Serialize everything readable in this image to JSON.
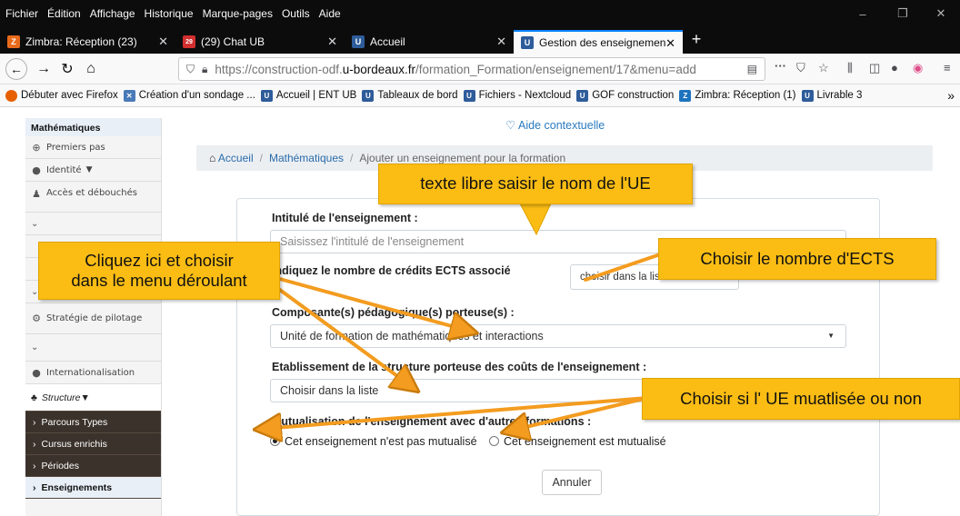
{
  "menubar": {
    "items": [
      "Fichier",
      "Édition",
      "Affichage",
      "Historique",
      "Marque-pages",
      "Outils",
      "Aide"
    ],
    "minimize": "–",
    "maximize": "❐",
    "close": "✕"
  },
  "tabs": [
    {
      "label": "Zimbra: Réception (23)",
      "favicon_color": "#e86a1b",
      "favicon_text": "Z"
    },
    {
      "label": "(29) Chat UB",
      "favicon_color": "#d32f2f",
      "favicon_text": "29"
    },
    {
      "label": "Accueil",
      "favicon_color": "#2e5c9a",
      "favicon_text": "U"
    },
    {
      "label": "Gestion des enseignemen",
      "favicon_color": "#2e5c9a",
      "favicon_text": "U",
      "active": true
    }
  ],
  "tab_close": "✕",
  "new_tab": "+",
  "navbar": {
    "url_prefix": "https://construction-odf.",
    "url_domain": "u-bordeaux.fr",
    "url_suffix": "/formation_Formation/enseignement/17&menu=add",
    "more": "···"
  },
  "bookmarks": [
    {
      "label": "Débuter avec Firefox",
      "color": "#e66000",
      "icon": "●"
    },
    {
      "label": "Création d'un sondage ...",
      "color": "#4a7ab8",
      "icon": "☒"
    },
    {
      "label": "Accueil | ENT UB",
      "color": "#2e5c9a",
      "icon": "U"
    },
    {
      "label": "Tableaux de bord",
      "color": "#2e5c9a",
      "icon": "U"
    },
    {
      "label": "Fichiers - Nextcloud",
      "color": "#2e5c9a",
      "icon": "U"
    },
    {
      "label": "GOF construction",
      "color": "#2e5c9a",
      "icon": "U"
    },
    {
      "label": "Zimbra: Réception (1)",
      "color": "#1e73be",
      "icon": "Z"
    },
    {
      "label": "Livrable 3",
      "color": "#2e5c9a",
      "icon": "U"
    }
  ],
  "bookmarks_more": "»",
  "sidebar": {
    "title": "Mathématiques",
    "premiers_pas": "Premiers pas",
    "identite": "Identité",
    "acces": "Accès et débouchés",
    "strategie": "Stratégie de pilotage",
    "internationalisation": "Internationalisation",
    "structure": "Structure",
    "parcours": "Parcours Types",
    "cursus": "Cursus enrichis",
    "periodes": "Périodes",
    "enseignements": "Enseignements"
  },
  "aide": "Aide contextuelle",
  "breadcrumb": {
    "home": "Accueil",
    "level1": "Mathématiques",
    "level2": "Ajouter un enseignement pour la formation"
  },
  "form": {
    "intitule_label": "Intitulé de l'enseignement :",
    "intitule_placeholder": "Saisissez l'intitulé de l'enseignement",
    "ects_label": "Indiquez le nombre de crédits ECTS associé",
    "ects_value": "choisir dans la liste",
    "composante_label": "Composante(s) pédagogique(s) porteuse(s) :",
    "composante_value": "Unité de formation de mathématiques et interactions",
    "etablissement_label": "Etablissement de la structure porteuse des coûts de l'enseignement :",
    "etablissement_value": "Choisir dans la liste",
    "mutualisation_label": "Mutualisation de l'enseignement avec d'autres formations :",
    "radio_non": "Cet enseignement n'est pas mutualisé",
    "radio_oui": "Cet enseignement est mutualisé",
    "annuler": "Annuler"
  },
  "callouts": {
    "nom_ue": "texte libre saisir le nom de l'UE",
    "menu_line1": "Cliquez ici et choisir",
    "menu_line2": "dans le menu déroulant",
    "ects": "Choisir le nombre d'ECTS",
    "mutualise": "Choisir si l' UE muatlisée ou non"
  },
  "colors": {
    "callout": "#fbbd14",
    "arrow": "#f39c1f",
    "link": "#2a6cab",
    "active_tab_border": "#0a84ff"
  }
}
